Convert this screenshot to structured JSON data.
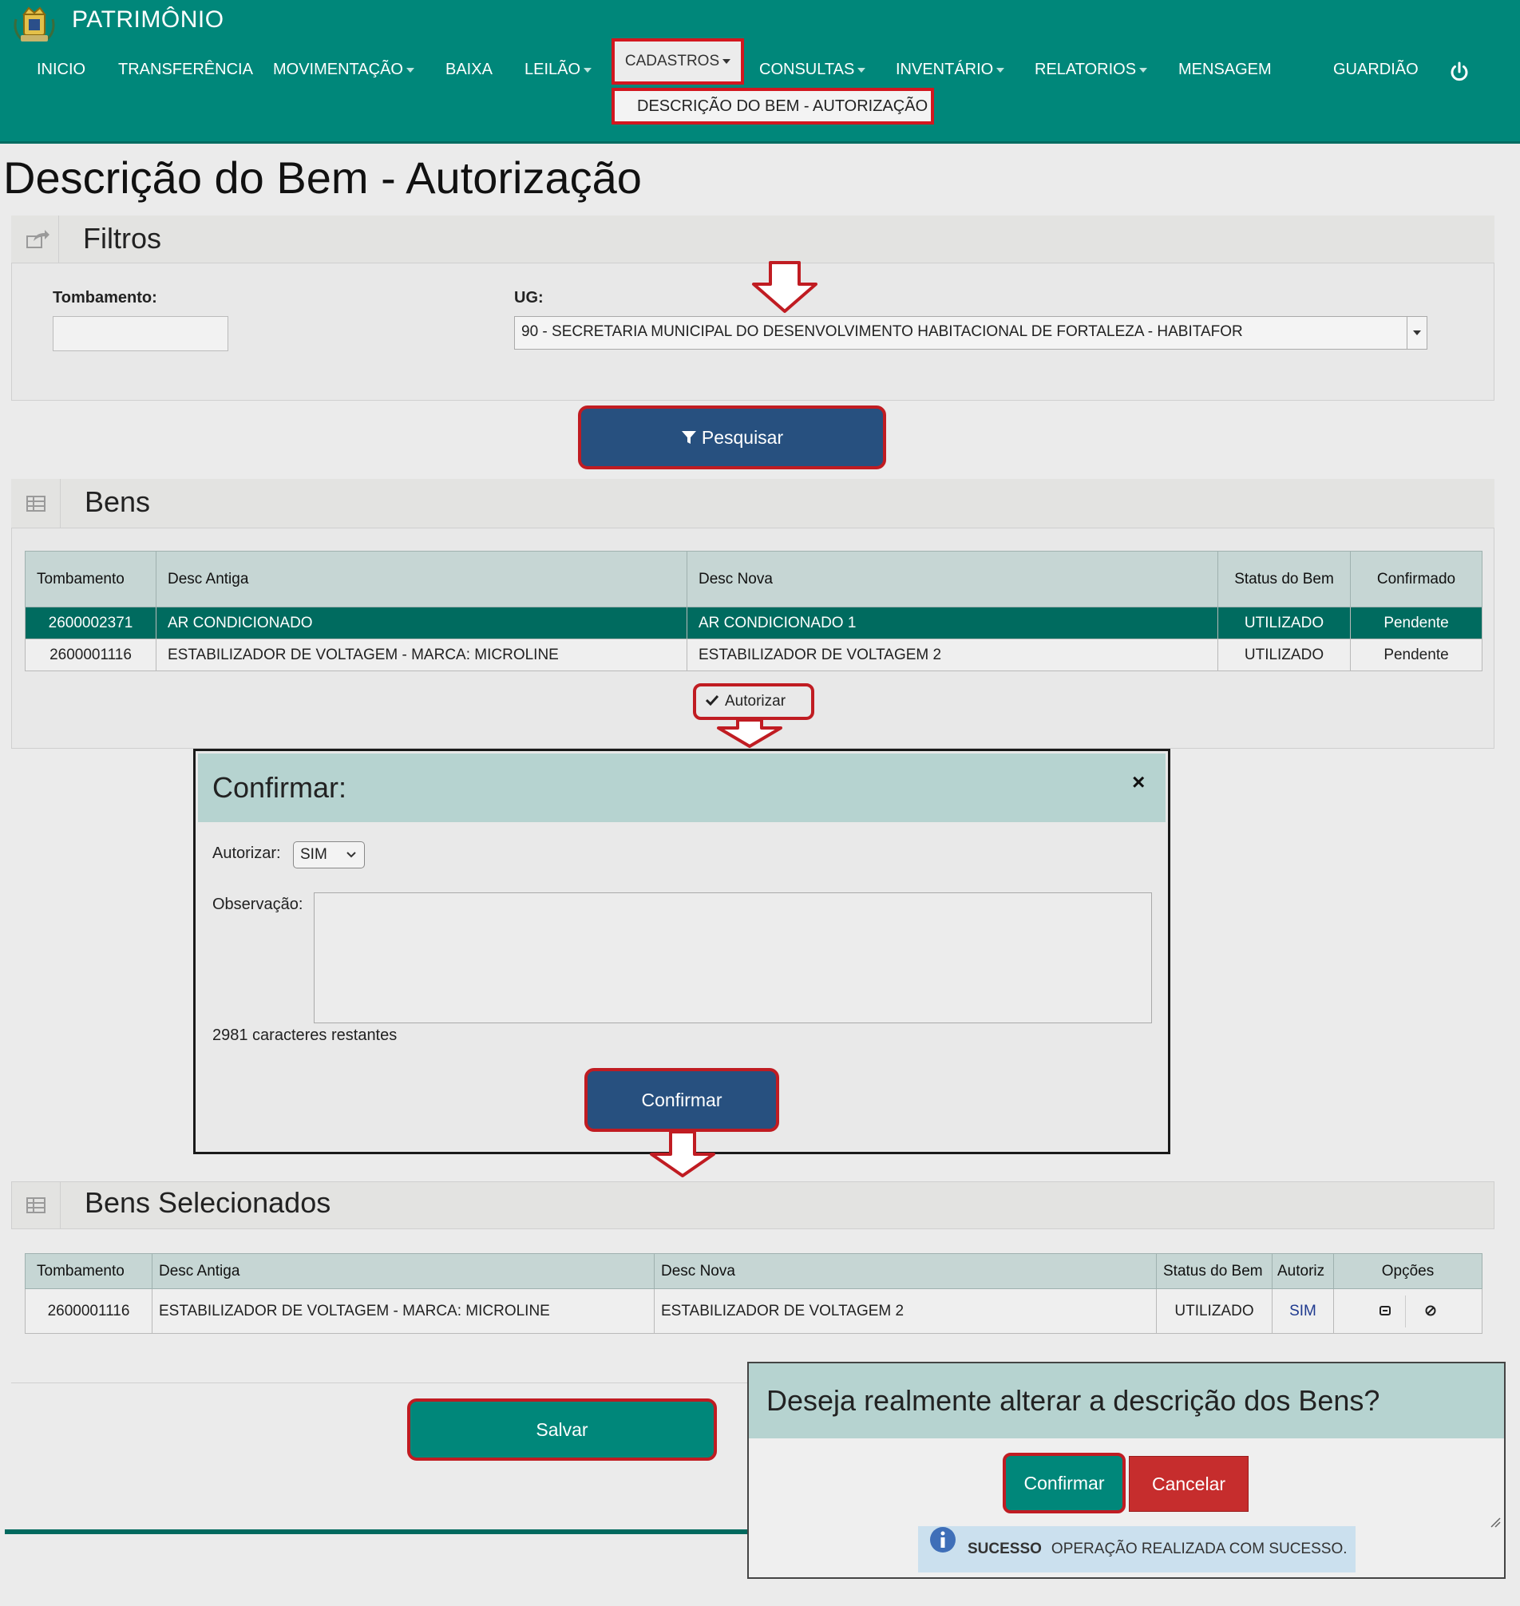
{
  "header": {
    "app_title": "PATRIMÔNIO"
  },
  "nav": {
    "items": [
      "INICIO",
      "TRANSFERÊNCIA",
      "MOVIMENTAÇÃO",
      "BAIXA",
      "LEILÃO",
      "CADASTROS",
      "CONSULTAS",
      "INVENTÁRIO",
      "RELATORIOS",
      "MENSAGEM",
      "GUARDIÃO"
    ],
    "dropdown_item": "DESCRIÇÃO DO BEM - AUTORIZAÇÃO"
  },
  "page_title": "Descrição do Bem - Autorização",
  "filters": {
    "title": "Filtros",
    "tombamento_label": "Tombamento:",
    "tombamento_value": "",
    "ug_label": "UG:",
    "ug_value": "90 - SECRETARIA MUNICIPAL DO DESENVOLVIMENTO HABITACIONAL DE FORTALEZA - HABITAFOR",
    "search_label": "Pesquisar"
  },
  "bens": {
    "title": "Bens",
    "columns": [
      "Tombamento",
      "Desc Antiga",
      "Desc Nova",
      "Status do Bem",
      "Confirmado"
    ],
    "rows": [
      [
        "2600002371",
        "AR CONDICIONADO",
        "AR CONDICIONADO 1",
        "UTILIZADO",
        "Pendente"
      ],
      [
        "2600001116",
        "ESTABILIZADOR DE VOLTAGEM - MARCA: MICROLINE",
        "ESTABILIZADOR DE VOLTAGEM 2",
        "UTILIZADO",
        "Pendente"
      ]
    ],
    "autorizar_label": "Autorizar"
  },
  "confirm_modal": {
    "title": "Confirmar:",
    "close": "×",
    "autorizar_label": "Autorizar:",
    "autorizar_value": "SIM",
    "obs_label": "Observação:",
    "obs_value": "",
    "chars_remaining": "2981 caracteres restantes",
    "confirm_label": "Confirmar"
  },
  "selected": {
    "title": "Bens Selecionados",
    "columns": [
      "Tombamento",
      "Desc Antiga",
      "Desc Nova",
      "Status do Bem",
      "Autoriz",
      "Opções"
    ],
    "rows": [
      [
        "2600001116",
        "ESTABILIZADOR DE VOLTAGEM - MARCA: MICROLINE",
        "ESTABILIZADOR DE VOLTAGEM 2",
        "UTILIZADO",
        "SIM"
      ]
    ],
    "save_label": "Salvar"
  },
  "dialog": {
    "question": "Deseja realmente alterar a descrição dos Bens?",
    "confirm_label": "Confirmar",
    "cancel_label": "Cancelar",
    "success_title": "SUCESSO",
    "success_message": "OPERAÇÃO REALIZADA COM SUCESSO."
  },
  "colors": {
    "brand_teal": "#00877a",
    "selected_row": "#006b5f",
    "primary_blue": "#27507f",
    "danger_red": "#c62d2d",
    "annotation_red": "#d2171f"
  }
}
